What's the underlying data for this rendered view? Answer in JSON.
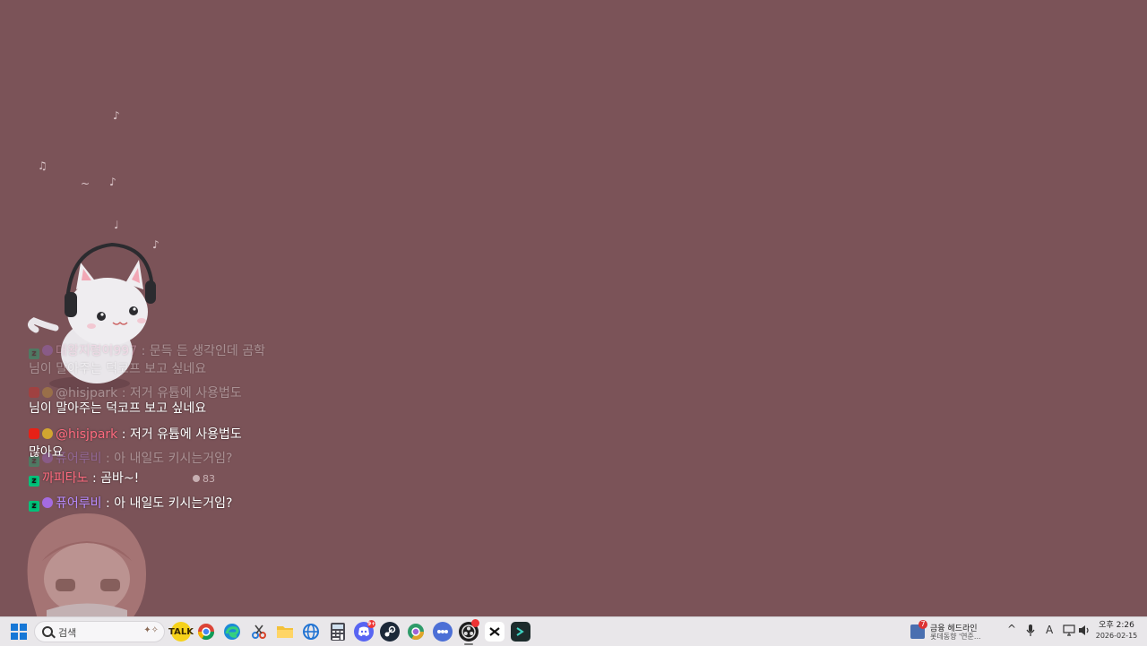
{
  "chat": {
    "faded": [
      {
        "nick": "대왕지렁이997",
        "text": " : 문득 든 생각인데 곰학",
        "cont": "님이 말아주는 덕코프 보고 싶네요"
      },
      {
        "nick": "@hisjpark",
        "text": " : 저거 유튭에 사용법도"
      },
      {
        "nick": "퓨어루비",
        "text": " : 아 내일도 키시는거임?"
      }
    ],
    "messages": [
      {
        "text": "님이 말아주는 덕코프 보고 싶네요"
      },
      {
        "nick": "@hisjpark",
        "text": " : 저거 유튭에 사용법도",
        "cont": "많아요"
      },
      {
        "nick": "까피타노",
        "text": " : 곰바~!"
      },
      {
        "nick": "퓨어루비",
        "text": " : 아 내일도 키시는거임?"
      }
    ],
    "viewer_count": "83"
  },
  "taskbar": {
    "search_placeholder": "검색",
    "news_badge": "7",
    "news_line1": "금융 헤드라인",
    "news_line2": "롯데동향 '연준...",
    "ime_label": "A",
    "clock_time": "오후 2:26",
    "clock_date": "2026-02-15",
    "discord_badge": "9+"
  },
  "colors": {
    "background": "#7b5358",
    "taskbar": "#e9e7ea"
  }
}
